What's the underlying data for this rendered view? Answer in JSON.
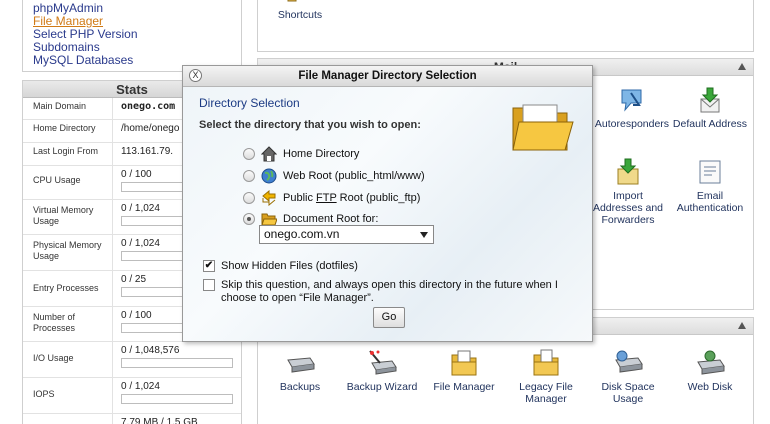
{
  "left_links": [
    "phpMyAdmin",
    "File Manager",
    "Select PHP Version",
    "Subdomains",
    "MySQL Databases"
  ],
  "stats": {
    "title": "Stats",
    "rows": [
      {
        "label": "Main Domain",
        "value": "onego.com",
        "bold": true
      },
      {
        "label": "Home Directory",
        "value": "/home/onego"
      },
      {
        "label": "Last Login From",
        "value": "113.161.79."
      },
      {
        "label": "CPU Usage",
        "value": "0 / 100",
        "bar": 0
      },
      {
        "label": "Virtual Memory Usage",
        "value": "0 / 1,024",
        "bar": 0
      },
      {
        "label": "Physical Memory Usage",
        "value": "0 / 1,024",
        "bar": 0
      },
      {
        "label": "Entry Processes",
        "value": "0 / 25",
        "bar": 0
      },
      {
        "label": "Number of Processes",
        "value": "0 / 100",
        "bar": 0
      },
      {
        "label": "I/O Usage",
        "value": "0 / 1,048,576",
        "bar": 0
      },
      {
        "label": "IOPS",
        "value": "0 / 1,024",
        "bar": 0
      },
      {
        "label": "",
        "value": "7.79 MB / 1.5 GB"
      }
    ]
  },
  "top_tile": {
    "label": "Shortcuts"
  },
  "mail_panel": {
    "title": "Mail",
    "tiles": [
      "Autoresponders",
      "Default Address",
      "Import Addresses and Forwarders",
      "Email Authentication"
    ]
  },
  "files_panel": {
    "tiles": [
      "Backups",
      "Backup Wizard",
      "File Manager",
      "Legacy File Manager",
      "Disk Space Usage",
      "Web Disk"
    ]
  },
  "modal": {
    "close_glyph": "X",
    "title": "File Manager Directory Selection",
    "heading": "Directory Selection",
    "prompt": "Select the directory that you wish to open:",
    "options": [
      {
        "label": "Home Directory",
        "icon": "home-icon",
        "selected": false
      },
      {
        "label": "Web Root (public_html/www)",
        "icon": "globe-icon",
        "selected": false
      },
      {
        "label_pre": "Public ",
        "label_ftp": "FTP",
        "label_post": " Root (public_ftp)",
        "icon": "ftp-arrows-icon",
        "selected": false
      },
      {
        "label": "Document Root for:",
        "icon": "folder-open-icon",
        "selected": true
      }
    ],
    "domain_select": "onego.com.vn",
    "show_hidden": {
      "label": "Show Hidden Files (dotfiles)",
      "checked": true
    },
    "skip": {
      "label": "Skip this question, and always open this directory in the future when I choose to open “File Manager”.",
      "checked": false
    },
    "go_label": "Go"
  }
}
